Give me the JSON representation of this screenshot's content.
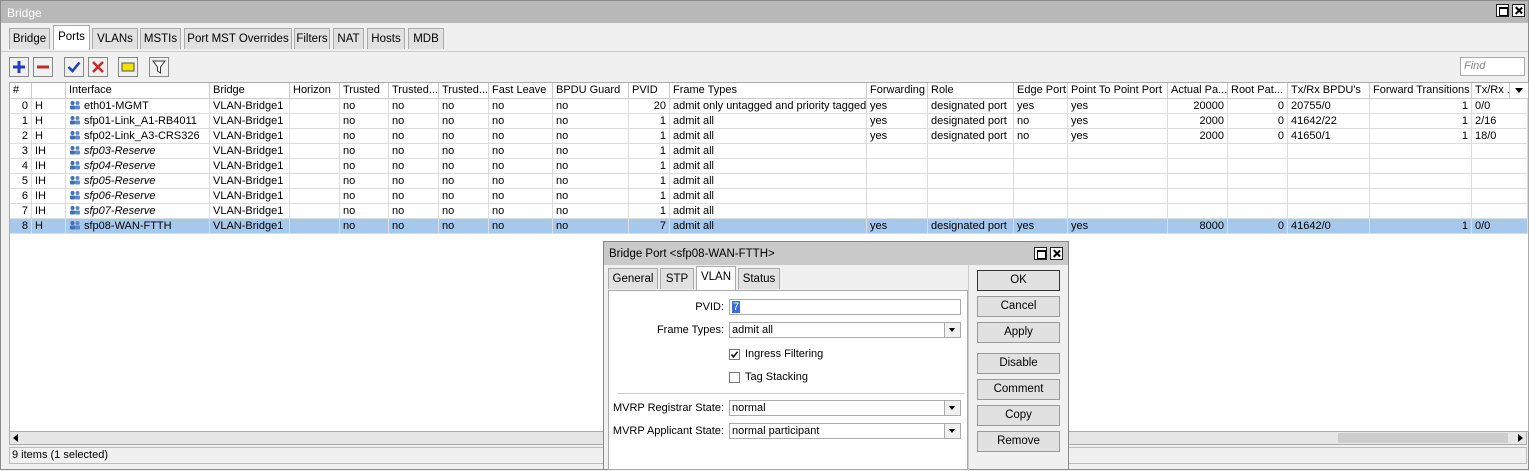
{
  "window": {
    "title": "Bridge"
  },
  "tabs": [
    "Bridge",
    "Ports",
    "VLANs",
    "MSTIs",
    "Port MST Overrides",
    "Filters",
    "NAT",
    "Hosts",
    "MDB"
  ],
  "active_tab": "Ports",
  "toolbar": {
    "find_placeholder": "Find"
  },
  "columns": [
    "#",
    "",
    "Interface",
    "Bridge",
    "Horizon",
    "Trusted",
    "Trusted...",
    "Trusted...",
    "Fast Leave",
    "BPDU Guard",
    "PVID",
    "Frame Types",
    "Forwarding",
    "Role",
    "Edge Port",
    "Point To Point Port",
    "Actual Pa...",
    "Root Pat...",
    "Tx/Rx BPDU's",
    "Forward Transitions",
    "Tx/Rx ..."
  ],
  "rows": [
    {
      "num": "0",
      "flags": "H",
      "interface": "eth01-MGMT",
      "bridge": "VLAN-Bridge1",
      "horizon": "",
      "t1": "no",
      "t2": "no",
      "t3": "no",
      "fast_leave": "no",
      "bpdu_guard": "no",
      "pvid": "20",
      "frame_types": "admit only untagged and priority tagged",
      "forwarding": "yes",
      "role": "designated port",
      "edge": "yes",
      "p2p": "yes",
      "actual_path": "20000",
      "root_path": "0",
      "bpdus": "20755/0",
      "fwd_trans": "1",
      "txrx": "0/0"
    },
    {
      "num": "1",
      "flags": "H",
      "interface": "sfp01-Link_A1-RB4011",
      "bridge": "VLAN-Bridge1",
      "horizon": "",
      "t1": "no",
      "t2": "no",
      "t3": "no",
      "fast_leave": "no",
      "bpdu_guard": "no",
      "pvid": "1",
      "frame_types": "admit all",
      "forwarding": "yes",
      "role": "designated port",
      "edge": "no",
      "p2p": "yes",
      "actual_path": "2000",
      "root_path": "0",
      "bpdus": "41642/22",
      "fwd_trans": "1",
      "txrx": "2/16"
    },
    {
      "num": "2",
      "flags": "H",
      "interface": "sfp02-Link_A3-CRS326",
      "bridge": "VLAN-Bridge1",
      "horizon": "",
      "t1": "no",
      "t2": "no",
      "t3": "no",
      "fast_leave": "no",
      "bpdu_guard": "no",
      "pvid": "1",
      "frame_types": "admit all",
      "forwarding": "yes",
      "role": "designated port",
      "edge": "no",
      "p2p": "yes",
      "actual_path": "2000",
      "root_path": "0",
      "bpdus": "41650/1",
      "fwd_trans": "1",
      "txrx": "18/0"
    },
    {
      "num": "3",
      "flags": "IH",
      "interface": "sfp03-Reserve",
      "bridge": "VLAN-Bridge1",
      "horizon": "",
      "t1": "no",
      "t2": "no",
      "t3": "no",
      "fast_leave": "no",
      "bpdu_guard": "no",
      "pvid": "1",
      "frame_types": "admit all",
      "forwarding": "",
      "role": "",
      "edge": "",
      "p2p": "",
      "actual_path": "",
      "root_path": "",
      "bpdus": "",
      "fwd_trans": "",
      "txrx": ""
    },
    {
      "num": "4",
      "flags": "IH",
      "interface": "sfp04-Reserve",
      "bridge": "VLAN-Bridge1",
      "horizon": "",
      "t1": "no",
      "t2": "no",
      "t3": "no",
      "fast_leave": "no",
      "bpdu_guard": "no",
      "pvid": "1",
      "frame_types": "admit all",
      "forwarding": "",
      "role": "",
      "edge": "",
      "p2p": "",
      "actual_path": "",
      "root_path": "",
      "bpdus": "",
      "fwd_trans": "",
      "txrx": ""
    },
    {
      "num": "5",
      "flags": "IH",
      "interface": "sfp05-Reserve",
      "bridge": "VLAN-Bridge1",
      "horizon": "",
      "t1": "no",
      "t2": "no",
      "t3": "no",
      "fast_leave": "no",
      "bpdu_guard": "no",
      "pvid": "1",
      "frame_types": "admit all",
      "forwarding": "",
      "role": "",
      "edge": "",
      "p2p": "",
      "actual_path": "",
      "root_path": "",
      "bpdus": "",
      "fwd_trans": "",
      "txrx": ""
    },
    {
      "num": "6",
      "flags": "IH",
      "interface": "sfp06-Reserve",
      "bridge": "VLAN-Bridge1",
      "horizon": "",
      "t1": "no",
      "t2": "no",
      "t3": "no",
      "fast_leave": "no",
      "bpdu_guard": "no",
      "pvid": "1",
      "frame_types": "admit all",
      "forwarding": "",
      "role": "",
      "edge": "",
      "p2p": "",
      "actual_path": "",
      "root_path": "",
      "bpdus": "",
      "fwd_trans": "",
      "txrx": ""
    },
    {
      "num": "7",
      "flags": "IH",
      "interface": "sfp07-Reserve",
      "bridge": "VLAN-Bridge1",
      "horizon": "",
      "t1": "no",
      "t2": "no",
      "t3": "no",
      "fast_leave": "no",
      "bpdu_guard": "no",
      "pvid": "1",
      "frame_types": "admit all",
      "forwarding": "",
      "role": "",
      "edge": "",
      "p2p": "",
      "actual_path": "",
      "root_path": "",
      "bpdus": "",
      "fwd_trans": "",
      "txrx": ""
    },
    {
      "num": "8",
      "flags": "H",
      "interface": "sfp08-WAN-FTTH",
      "bridge": "VLAN-Bridge1",
      "horizon": "",
      "t1": "no",
      "t2": "no",
      "t3": "no",
      "fast_leave": "no",
      "bpdu_guard": "no",
      "pvid": "7",
      "frame_types": "admit all",
      "forwarding": "yes",
      "role": "designated port",
      "edge": "yes",
      "p2p": "yes",
      "actual_path": "8000",
      "root_path": "0",
      "bpdus": "41642/0",
      "fwd_trans": "1",
      "txrx": "0/0"
    }
  ],
  "selected_row": 8,
  "status": {
    "text": "9 items (1 selected)"
  },
  "dialog": {
    "title": "Bridge Port <sfp08-WAN-FTTH>",
    "tabs": [
      "General",
      "STP",
      "VLAN",
      "Status"
    ],
    "active_tab": "VLAN",
    "pvid_label": "PVID:",
    "pvid_value": "7",
    "frame_types_label": "Frame Types:",
    "frame_types_value": "admit all",
    "ingress_filtering_label": "Ingress Filtering",
    "ingress_filtering_checked": true,
    "tag_stacking_label": "Tag Stacking",
    "tag_stacking_checked": false,
    "mvrp_registrar_label": "MVRP Registrar State:",
    "mvrp_registrar_value": "normal",
    "mvrp_applicant_label": "MVRP Applicant State:",
    "mvrp_applicant_value": "normal participant",
    "buttons": {
      "ok": "OK",
      "cancel": "Cancel",
      "apply": "Apply",
      "disable": "Disable",
      "comment": "Comment",
      "copy": "Copy",
      "remove": "Remove"
    }
  },
  "colors": {
    "selection": "#a6c8ec",
    "add": "#1f3fbf",
    "remove": "#c62828",
    "enable": "#1f3fbf",
    "disable": "#c62828",
    "comment": "#f2e200"
  },
  "icons": [
    "add-icon",
    "remove-icon",
    "enable-icon",
    "disable-icon",
    "comment-icon",
    "filter-icon",
    "interface-icon"
  ]
}
